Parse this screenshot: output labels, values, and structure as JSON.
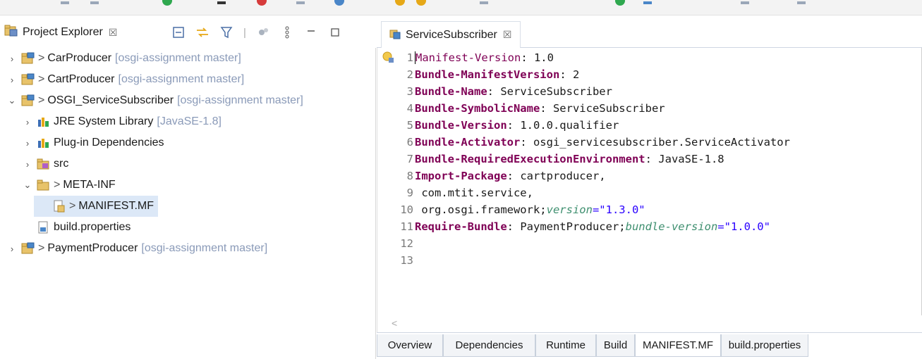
{
  "project_explorer": {
    "title": "Project Explorer",
    "close_glyph": "☒",
    "tools": [
      "collapse-all-icon",
      "link-with-editor-icon",
      "filter-icon",
      "focus-icon",
      "view-menu-icon",
      "minimize-icon",
      "maximize-icon"
    ],
    "tree": [
      {
        "depth": 0,
        "chevron": "›",
        "prefix": ">",
        "label": "CarProducer",
        "decoration": "[osgi-assignment master]",
        "icon": "project-icon"
      },
      {
        "depth": 0,
        "chevron": "›",
        "prefix": ">",
        "label": "CartProducer",
        "decoration": "[osgi-assignment master]",
        "icon": "project-icon"
      },
      {
        "depth": 0,
        "chevron": "⌄",
        "prefix": ">",
        "label": "OSGI_ServiceSubscriber",
        "decoration": "[osgi-assignment master]",
        "icon": "project-icon"
      },
      {
        "depth": 1,
        "chevron": "›",
        "prefix": "",
        "label": "JRE System Library",
        "decoration": "[JavaSE-1.8]",
        "icon": "library-icon"
      },
      {
        "depth": 1,
        "chevron": "›",
        "prefix": "",
        "label": "Plug-in Dependencies",
        "decoration": "",
        "icon": "library-icon"
      },
      {
        "depth": 1,
        "chevron": "›",
        "prefix": "",
        "label": "src",
        "decoration": "",
        "icon": "source-folder-icon"
      },
      {
        "depth": 1,
        "chevron": "⌄",
        "prefix": ">",
        "label": "META-INF",
        "decoration": "",
        "icon": "folder-icon"
      },
      {
        "depth": 2,
        "chevron": "",
        "prefix": ">",
        "label": "MANIFEST.MF",
        "decoration": "",
        "icon": "manifest-file-icon",
        "selected": true
      },
      {
        "depth": 1,
        "chevron": "",
        "prefix": "",
        "label": "build.properties",
        "decoration": "",
        "icon": "properties-file-icon"
      },
      {
        "depth": 0,
        "chevron": "›",
        "prefix": ">",
        "label": "PaymentProducer",
        "decoration": "[osgi-assignment master]",
        "icon": "project-icon"
      }
    ]
  },
  "editor": {
    "tab_title": "ServiceSubscriber",
    "close_glyph": "☒",
    "lines": [
      {
        "n": "1",
        "key": "Manifest-Version",
        "rest": ": 1.0"
      },
      {
        "n": "2",
        "key": "Bundle-ManifestVersion",
        "rest": ": 2"
      },
      {
        "n": "3",
        "key": "Bundle-Name",
        "rest": ": ServiceSubscriber"
      },
      {
        "n": "4",
        "key": "Bundle-SymbolicName",
        "rest": ": ServiceSubscriber"
      },
      {
        "n": "5",
        "key": "Bundle-Version",
        "rest": ": 1.0.0.qualifier"
      },
      {
        "n": "6",
        "key": "Bundle-Activator",
        "rest": ": osgi_servicesubscriber.ServiceActivator"
      },
      {
        "n": "7",
        "key": "Bundle-RequiredExecutionEnvironment",
        "rest": ": JavaSE-1.8"
      },
      {
        "n": "8",
        "key": "Import-Package",
        "rest": ": cartproducer,"
      },
      {
        "n": "9",
        "key": "",
        "rest": " com.mtit.service,"
      },
      {
        "n": "10",
        "key": "",
        "rest": " org.osgi.framework;",
        "attr": "version",
        "str": "=\"1.3.0\""
      },
      {
        "n": "11",
        "key": "Require-Bundle",
        "rest": ": PaymentProducer;",
        "attr": "bundle-version",
        "str": "=\"1.0.0\""
      },
      {
        "n": "12",
        "key": "",
        "rest": ""
      },
      {
        "n": "13",
        "key": "",
        "rest": ""
      }
    ],
    "scroll_left_glyph": "<",
    "bottom_tabs": [
      "Overview",
      "Dependencies",
      "Runtime",
      "Build",
      "MANIFEST.MF",
      "build.properties"
    ],
    "active_bottom_tab": "MANIFEST.MF"
  },
  "colors": {
    "keyword": "#7f0055",
    "attribute": "#3e8f6f",
    "string": "#2a00ff",
    "selection": "#dce8f7",
    "decoration": "#8a9ab8"
  }
}
